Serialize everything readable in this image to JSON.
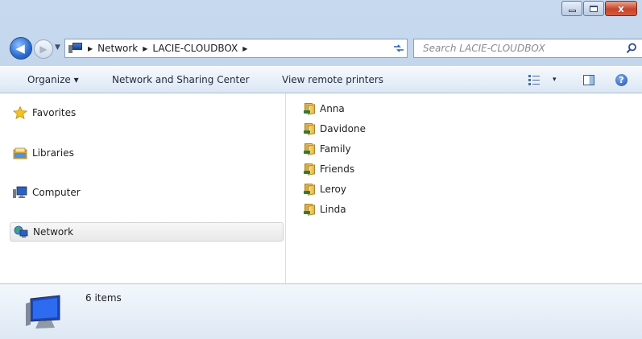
{
  "window": {
    "caption": {
      "minimize": "–",
      "maximize": "□",
      "close": "x"
    }
  },
  "nav": {
    "back_icon": "back-arrow-icon",
    "forward_icon": "forward-arrow-icon",
    "breadcrumbs": [
      "Network",
      "LACIE-CLOUDBOX"
    ],
    "search_placeholder": "Search LACIE-CLOUDBOX"
  },
  "toolbar": {
    "organize": "Organize ▾",
    "network_sharing": "Network and Sharing Center",
    "view_printers": "View remote printers",
    "views_dropdown": "▾",
    "help": "?"
  },
  "sidebar": {
    "items": [
      {
        "label": "Favorites",
        "icon": "star-icon"
      },
      {
        "label": "Libraries",
        "icon": "libraries-icon"
      },
      {
        "label": "Computer",
        "icon": "computer-icon"
      },
      {
        "label": "Network",
        "icon": "network-icon",
        "selected": true
      }
    ]
  },
  "content": {
    "folders": [
      "Anna",
      "Davidone",
      "Family",
      "Friends",
      "Leroy",
      "Linda"
    ]
  },
  "details": {
    "count_text": "6 items"
  },
  "colors": {
    "accent": "#2a6bd2",
    "frame": "#c7d9ee",
    "close": "#c7442a"
  }
}
